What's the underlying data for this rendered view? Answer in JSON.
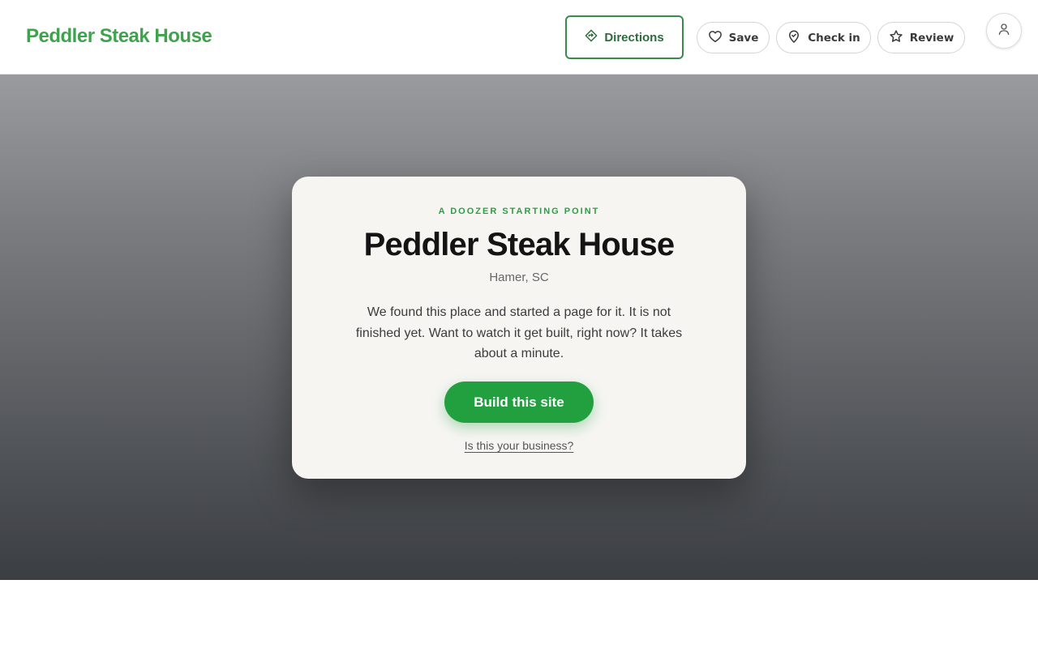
{
  "header": {
    "brand": "Peddler Steak House",
    "directions_label": "Directions",
    "save_label": "Save",
    "checkin_label": "Check in",
    "review_label": "Review"
  },
  "card": {
    "eyebrow": "A DOOZER STARTING POINT",
    "title": "Peddler Steak House",
    "location": "Hamer, SC",
    "description": "We found this place and started a page for it. It is not finished yet. Want to watch it get built, right now? It takes about a minute.",
    "cta_label": "Build this site",
    "claim_label": "Is this your business?"
  },
  "colors": {
    "brand_green": "#3fa34d",
    "cta_green": "#22a040",
    "directions_border": "#3a8a4b"
  },
  "icons": {
    "directions": "directions-icon",
    "save": "heart-icon",
    "checkin": "map-pin-icon",
    "review": "star-icon",
    "account": "user-icon"
  }
}
